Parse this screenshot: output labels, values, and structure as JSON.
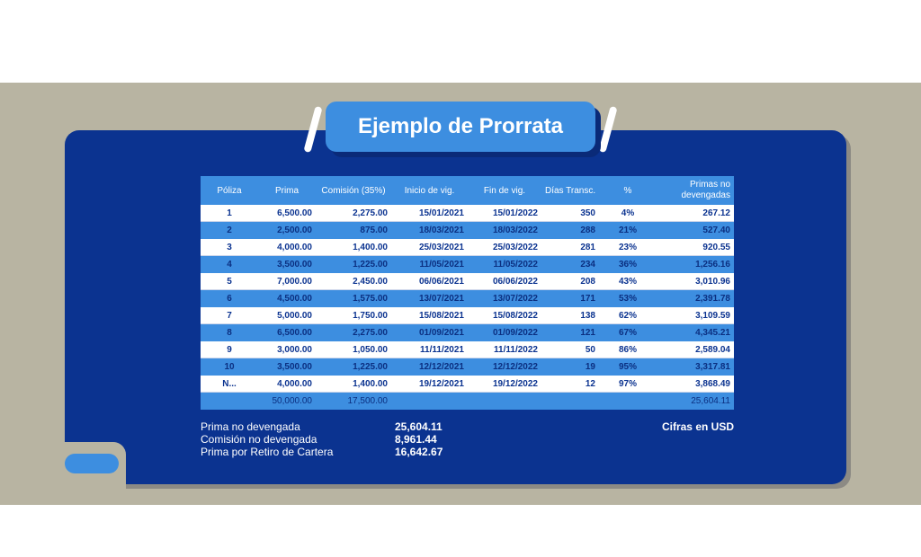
{
  "title": "Ejemplo de Prorrata",
  "columns": [
    "Póliza",
    "Prima",
    "Comisión (35%)",
    "Inicio de vig.",
    "Fin de vig.",
    "Días Transc.",
    "%",
    "Primas no devengadas"
  ],
  "rows": [
    [
      "1",
      "6,500.00",
      "2,275.00",
      "15/01/2021",
      "15/01/2022",
      "350",
      "4%",
      "267.12"
    ],
    [
      "2",
      "2,500.00",
      "875.00",
      "18/03/2021",
      "18/03/2022",
      "288",
      "21%",
      "527.40"
    ],
    [
      "3",
      "4,000.00",
      "1,400.00",
      "25/03/2021",
      "25/03/2022",
      "281",
      "23%",
      "920.55"
    ],
    [
      "4",
      "3,500.00",
      "1,225.00",
      "11/05/2021",
      "11/05/2022",
      "234",
      "36%",
      "1,256.16"
    ],
    [
      "5",
      "7,000.00",
      "2,450.00",
      "06/06/2021",
      "06/06/2022",
      "208",
      "43%",
      "3,010.96"
    ],
    [
      "6",
      "4,500.00",
      "1,575.00",
      "13/07/2021",
      "13/07/2022",
      "171",
      "53%",
      "2,391.78"
    ],
    [
      "7",
      "5,000.00",
      "1,750.00",
      "15/08/2021",
      "15/08/2022",
      "138",
      "62%",
      "3,109.59"
    ],
    [
      "8",
      "6,500.00",
      "2,275.00",
      "01/09/2021",
      "01/09/2022",
      "121",
      "67%",
      "4,345.21"
    ],
    [
      "9",
      "3,000.00",
      "1,050.00",
      "11/11/2021",
      "11/11/2022",
      "50",
      "86%",
      "2,589.04"
    ],
    [
      "10",
      "3,500.00",
      "1,225.00",
      "12/12/2021",
      "12/12/2022",
      "19",
      "95%",
      "3,317.81"
    ],
    [
      "N...",
      "4,000.00",
      "1,400.00",
      "19/12/2021",
      "19/12/2022",
      "12",
      "97%",
      "3,868.49"
    ]
  ],
  "totals": [
    "",
    "50,000.00",
    "17,500.00",
    "",
    "",
    "",
    "",
    "25,604.11"
  ],
  "summary": [
    {
      "label": "Prima no devengada",
      "value": "25,604.11"
    },
    {
      "label": "Comisión no devengada",
      "value": "8,961.44"
    },
    {
      "label": "Prima por Retiro de Cartera",
      "value": "16,642.67"
    }
  ],
  "note": "Cifras en USD",
  "colors": {
    "navy": "#0b3390",
    "blue": "#3d8ee0",
    "beige": "#b8b4a2"
  }
}
